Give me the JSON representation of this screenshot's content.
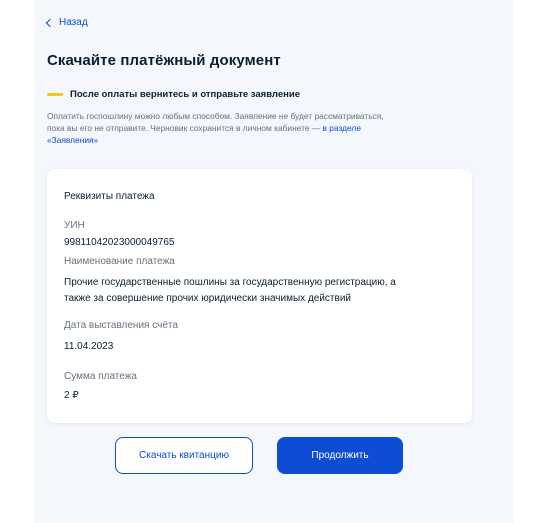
{
  "header": {
    "back_label": "Назад",
    "title": "Скачайте платёжный документ"
  },
  "notice": {
    "heading": "После оплаты вернитесь и отправьте заявление",
    "text_line1": "Оплатить госпошлину можно любым способом. Заявление не будет рассматриваться,",
    "text_line2_prefix": "пока вы его не отправите. Черновик сохранится в личном кабинете — ",
    "link_part1": "в разделе",
    "link_part2": "«Заявления»",
    "accent_color": "#fcc419"
  },
  "payment": {
    "title": "Реквизиты платежа",
    "uin_label": "УИН",
    "uin_value": "99811042023000049765",
    "name_label": "Наименование платежа",
    "name_value_line1": "Прочие государственные пошлины за государственную регистрацию, а",
    "name_value_line2": "также за совершение прочих юридически значимых действий",
    "date_label": "Дата выставления счёта",
    "date_value": "11.04.2023",
    "amount_label": "Сумма платежа",
    "amount_value": "2 ₽"
  },
  "actions": {
    "download_label": "Скачать квитанцию",
    "continue_label": "Продолжить"
  },
  "colors": {
    "primary": "#0d4cd3",
    "text": "#0b1f33",
    "muted": "#66727f",
    "panel_bg": "#f4f7fb"
  }
}
